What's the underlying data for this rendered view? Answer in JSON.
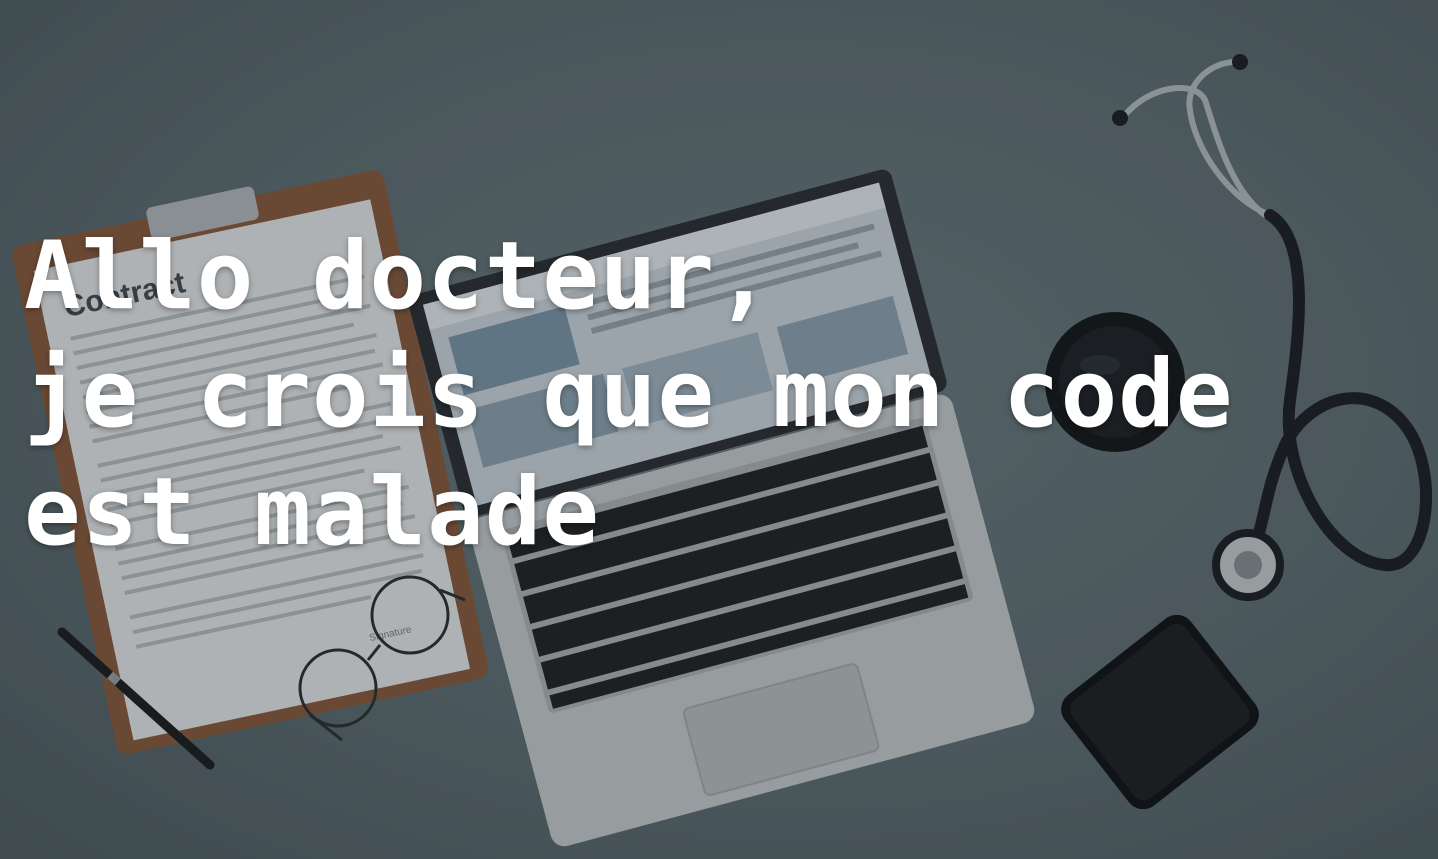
{
  "scene": {
    "description_free": true,
    "background_color": "#5e6d72",
    "clipboard_heading": "Contract",
    "signature_label": "Signature"
  },
  "headline": {
    "line1": "Allo docteur,",
    "line2": "je crois que mon code",
    "line3": "est malade"
  },
  "icons": [
    "clipboard-icon",
    "laptop-icon",
    "stethoscope-icon",
    "coffee-cup-icon",
    "smartphone-icon",
    "glasses-icon",
    "pen-icon"
  ]
}
